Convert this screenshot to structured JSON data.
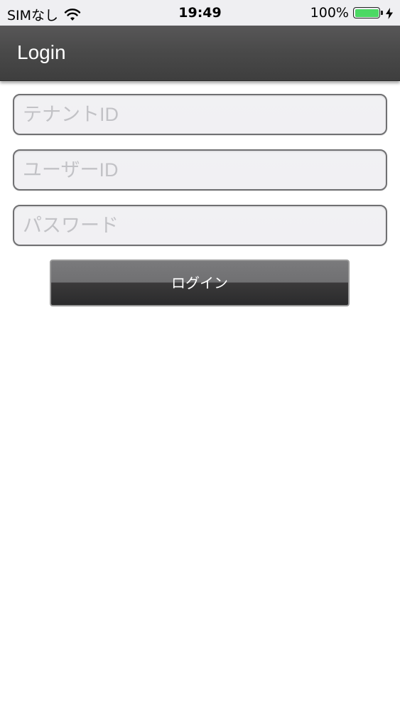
{
  "status_bar": {
    "carrier": "SIMなし",
    "time": "19:49",
    "battery_percent": "100%",
    "battery_level": 1.0,
    "battery_color": "#4cd964",
    "icons": [
      "wifi-icon",
      "battery-icon",
      "charging-bolt-icon"
    ]
  },
  "nav": {
    "title": "Login"
  },
  "form": {
    "tenant_id": {
      "placeholder": "テナントID",
      "value": ""
    },
    "user_id": {
      "placeholder": "ユーザーID",
      "value": ""
    },
    "password": {
      "placeholder": "パスワード",
      "value": ""
    },
    "login_button_label": "ログイン"
  },
  "colors": {
    "nav_background": "#4a4a4a",
    "button_dark": "#2b2b2c",
    "input_background": "#f1f1f3",
    "placeholder": "#c2c2c6"
  }
}
